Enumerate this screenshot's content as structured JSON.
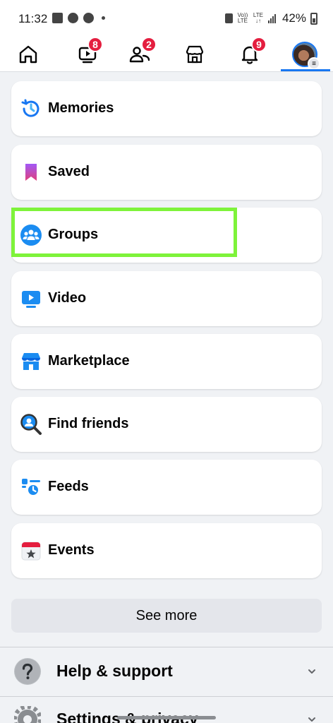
{
  "status_bar": {
    "time": "11:32",
    "battery": "42%",
    "network_1": "Vo)) LTE",
    "network_2": "LTE ↓↑"
  },
  "nav": {
    "tabs": [
      {
        "name": "home",
        "icon": "home-icon",
        "badge": null
      },
      {
        "name": "video",
        "icon": "video-icon",
        "badge": "8"
      },
      {
        "name": "friends",
        "icon": "friends-icon",
        "badge": "2"
      },
      {
        "name": "marketplace",
        "icon": "store-icon",
        "badge": null
      },
      {
        "name": "notifications",
        "icon": "bell-icon",
        "badge": "9"
      },
      {
        "name": "menu",
        "icon": "profile-avatar",
        "badge": null
      }
    ],
    "active_tab": "menu",
    "accent_color": "#1877f2",
    "badge_color": "#e41e3f"
  },
  "shortcuts": [
    {
      "label": "Memories",
      "icon": "memories-clock-icon"
    },
    {
      "label": "Saved",
      "icon": "bookmark-icon"
    },
    {
      "label": "Groups",
      "icon": "groups-icon",
      "highlighted": true
    },
    {
      "label": "Video",
      "icon": "video-play-icon"
    },
    {
      "label": "Marketplace",
      "icon": "marketplace-store-icon"
    },
    {
      "label": "Find friends",
      "icon": "find-friends-icon"
    },
    {
      "label": "Feeds",
      "icon": "feeds-icon"
    },
    {
      "label": "Events",
      "icon": "calendar-star-icon"
    }
  ],
  "highlight_color": "#7ef33a",
  "see_more_label": "See more",
  "sections": [
    {
      "label": "Help & support",
      "icon": "question-mark-icon"
    },
    {
      "label": "Settings & privacy",
      "icon": "gear-icon"
    }
  ]
}
